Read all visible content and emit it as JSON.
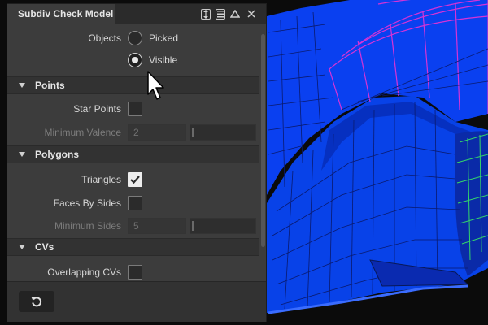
{
  "window": {
    "title": "Subdiv Check Model",
    "icons": [
      "dock-arrows-icon",
      "menu-icon",
      "triangle-icon",
      "close-icon"
    ]
  },
  "objects": {
    "label": "Objects",
    "options": [
      {
        "label": "Picked",
        "selected": false
      },
      {
        "label": "Visible",
        "selected": true
      }
    ]
  },
  "sections": {
    "points": {
      "title": "Points",
      "star_points": {
        "label": "Star Points",
        "checked": false
      },
      "minimum_valence": {
        "label": "Minimum Valence",
        "value": "2",
        "enabled": false
      }
    },
    "polygons": {
      "title": "Polygons",
      "triangles": {
        "label": "Triangles",
        "checked": true
      },
      "faces_by_sides": {
        "label": "Faces By Sides",
        "checked": false
      },
      "minimum_sides": {
        "label": "Minimum Sides",
        "value": "5",
        "enabled": false
      }
    },
    "cvs": {
      "title": "CVs",
      "overlapping_cvs": {
        "label": "Overlapping CVs",
        "checked": false
      }
    }
  },
  "footer": {
    "reset_icon": "reset-icon"
  },
  "colors": {
    "panel_bg": "#3c3c3c",
    "titlebar_bg": "#2b2b2b",
    "mesh_fill": "#0a40f0",
    "mesh_lines": "#0a1a6e",
    "highlight_magenta": "#d633d6",
    "highlight_green": "#33d66a"
  }
}
